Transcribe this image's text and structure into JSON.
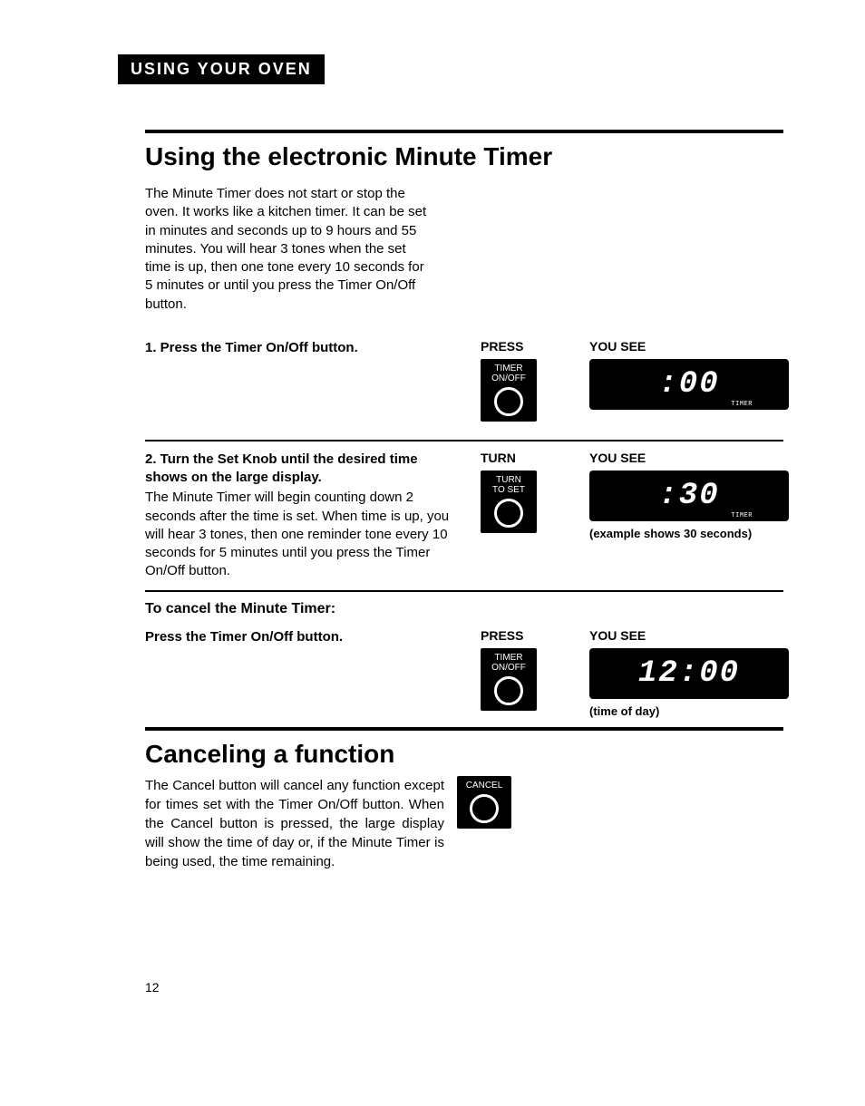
{
  "header": "USING YOUR OVEN",
  "section1": {
    "title": "Using the electronic Minute Timer",
    "intro": "The Minute Timer does not start or stop the oven. It works like a kitchen timer. It can be set in minutes and seconds up to 9 hours and 55 minutes. You will hear 3 tones when the set time is up, then one tone every 10 seconds for 5 minutes or until you press the Timer On/Off button."
  },
  "step1": {
    "heading": "1. Press the Timer On/Off button.",
    "press_label": "PRESS",
    "see_label": "YOU SEE",
    "button_line1": "TIMER",
    "button_line2": "ON/OFF",
    "display": ":00",
    "display_sub": "TIMER"
  },
  "step2": {
    "heading": "2. Turn the Set Knob until the desired time shows on the large display.",
    "body": "The Minute Timer will begin counting down 2 seconds after the time is set. When time is up, you will hear 3 tones, then one reminder tone every 10 seconds for 5 minutes until you press the Timer On/Off button.",
    "turn_label": "TURN",
    "see_label": "YOU SEE",
    "button_line1": "TURN",
    "button_line2": "TO SET",
    "display": ":30",
    "display_sub": "TIMER",
    "caption": "(example shows 30 seconds)"
  },
  "cancel_timer": {
    "heading": "To cancel the Minute Timer:",
    "text": "Press the Timer On/Off button.",
    "press_label": "PRESS",
    "see_label": "YOU SEE",
    "button_line1": "TIMER",
    "button_line2": "ON/OFF",
    "display": "12:00",
    "caption": "(time of day)"
  },
  "section2": {
    "title": "Canceling a function",
    "body": "The Cancel button will cancel any function except for times set with the Timer On/Off button. When the Cancel button is pressed, the large display will show the time of day or, if the Minute Timer is being used, the time remaining.",
    "button_label": "CANCEL"
  },
  "page_number": "12"
}
